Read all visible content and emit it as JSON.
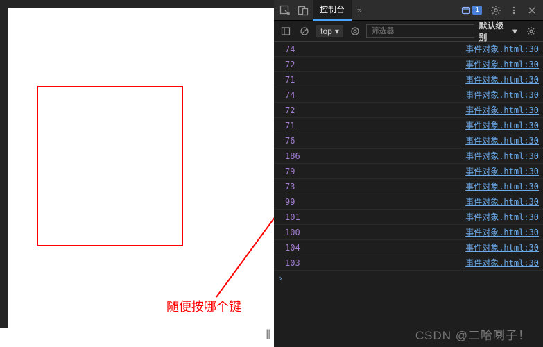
{
  "annotation": "随便按哪个键",
  "watermark": "CSDN @二哈喇子！",
  "devtools": {
    "tabs": {
      "active": "控制台",
      "chevron": "»"
    },
    "badge_count": "1",
    "toolbar": {
      "context": "top",
      "filter_placeholder": "筛选器",
      "level_label": "默认级别"
    },
    "rows": [
      {
        "val": "74",
        "src": "事件对象.html:30"
      },
      {
        "val": "72",
        "src": "事件对象.html:30"
      },
      {
        "val": "71",
        "src": "事件对象.html:30"
      },
      {
        "val": "74",
        "src": "事件对象.html:30"
      },
      {
        "val": "72",
        "src": "事件对象.html:30"
      },
      {
        "val": "71",
        "src": "事件对象.html:30"
      },
      {
        "val": "76",
        "src": "事件对象.html:30"
      },
      {
        "val": "186",
        "src": "事件对象.html:30"
      },
      {
        "val": "79",
        "src": "事件对象.html:30"
      },
      {
        "val": "73",
        "src": "事件对象.html:30"
      },
      {
        "val": "99",
        "src": "事件对象.html:30"
      },
      {
        "val": "101",
        "src": "事件对象.html:30"
      },
      {
        "val": "100",
        "src": "事件对象.html:30"
      },
      {
        "val": "104",
        "src": "事件对象.html:30"
      },
      {
        "val": "103",
        "src": "事件对象.html:30"
      }
    ]
  }
}
